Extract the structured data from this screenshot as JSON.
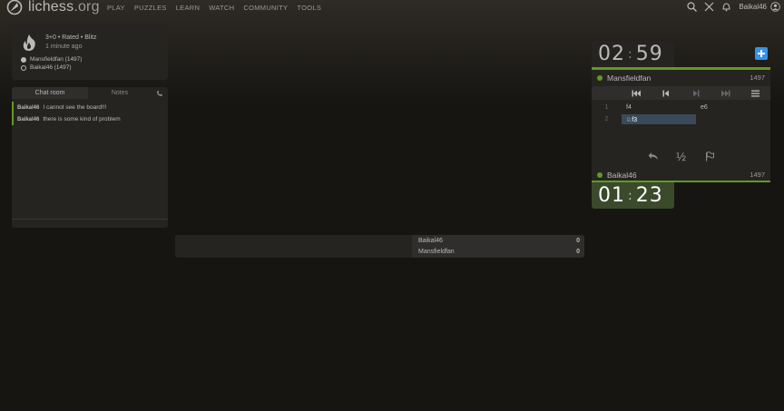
{
  "header": {
    "logo_text": "lichess",
    "logo_tld": ".org",
    "nav": [
      "PLAY",
      "PUZZLES",
      "LEARN",
      "WATCH",
      "COMMUNITY",
      "TOOLS"
    ],
    "username": "Baikal46"
  },
  "game_info": {
    "setup": "3+0 • Rated • Blitz",
    "time_ago": "1 minute ago",
    "white_player": "Mansfieldfan (1497)",
    "black_player": "Baikal46 (1497)"
  },
  "chat": {
    "tab_chat": "Chat room",
    "tab_notes": "Notes",
    "messages": [
      {
        "user": "Baikal46",
        "text": "I cannot see the board!!!"
      },
      {
        "user": "Baikal46",
        "text": "there is some kind of problem"
      }
    ]
  },
  "crosstable": {
    "rows": [
      {
        "name": "Baikal46",
        "score": "0"
      },
      {
        "name": "Mansfieldfan",
        "score": "0"
      }
    ]
  },
  "clocks": {
    "top": {
      "min": "02",
      "sec": "59"
    },
    "bottom": {
      "min": "01",
      "sec": "23"
    }
  },
  "players": {
    "top": {
      "name": "Mansfieldfan",
      "rating": "1497"
    },
    "bottom": {
      "name": "Baikal46",
      "rating": "1497"
    }
  },
  "moves": [
    {
      "num": "1",
      "white": "f4",
      "black": "e6"
    },
    {
      "num": "2",
      "white": "♘f3",
      "black": ""
    }
  ],
  "controls": {
    "draw_label": "½"
  },
  "colors": {
    "accent_green": "#629924",
    "accent_blue": "#3692e7",
    "background": "#161512",
    "panel": "#262421"
  }
}
